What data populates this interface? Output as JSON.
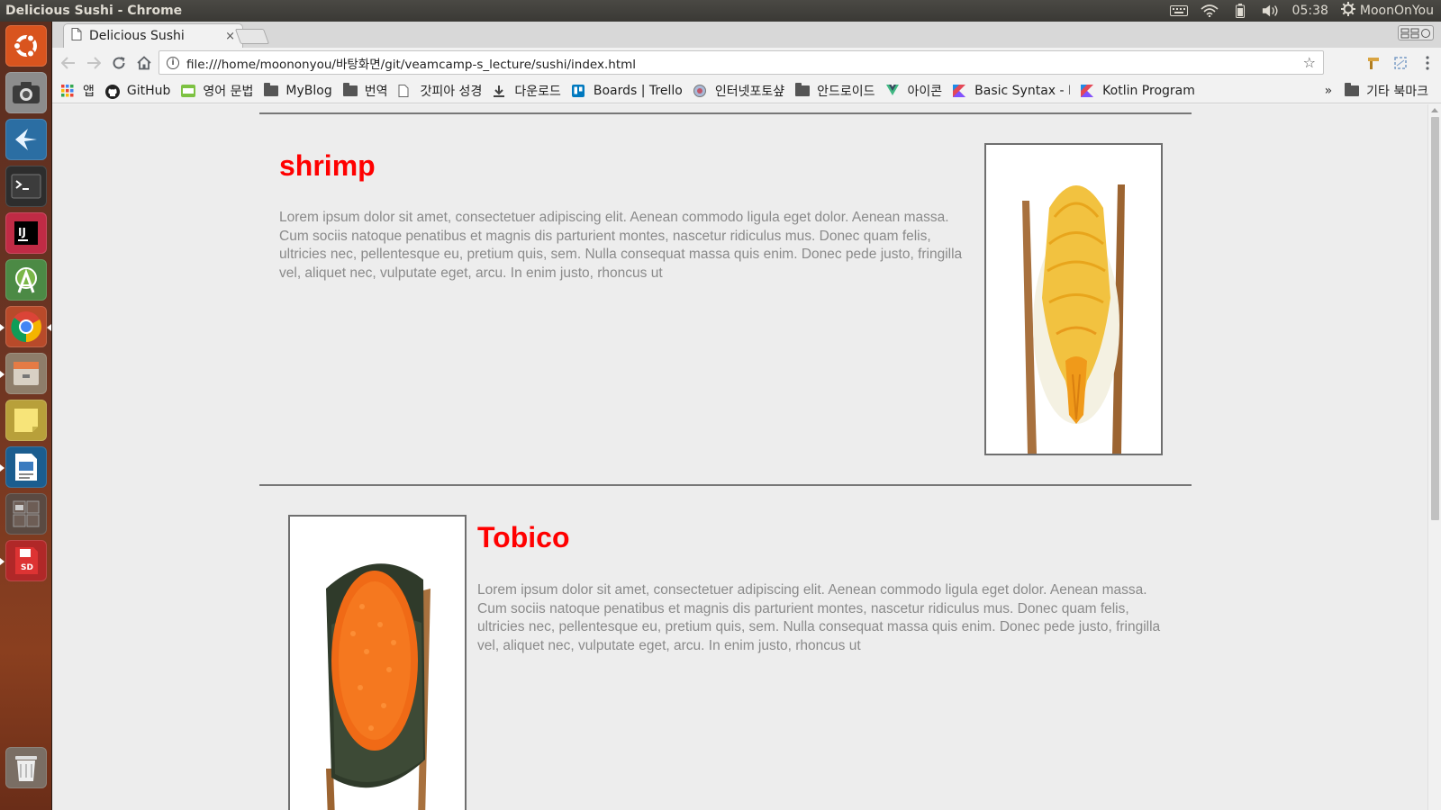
{
  "window": {
    "title": "Delicious Sushi - Chrome"
  },
  "panel": {
    "time": "05:38",
    "user": "MoonOnYou"
  },
  "launcher": {
    "items": [
      "ubuntu-dash",
      "screenshot",
      "remmina",
      "terminal",
      "intellij",
      "android-studio",
      "chrome",
      "files",
      "sticky-notes",
      "writer",
      "workspaces",
      "sd-app",
      "trash"
    ]
  },
  "tab": {
    "title": "Delicious Sushi",
    "close": "×"
  },
  "omnibox": {
    "url": "file:///home/moononyou/바탕화면/git/veamcamp-s_lecture/sushi/index.html"
  },
  "bookmarks": {
    "items": [
      {
        "label": "앱",
        "icon": "apps-grid-icon"
      },
      {
        "label": "GitHub",
        "icon": "github-icon"
      },
      {
        "label": "영어 문법",
        "icon": "blog-icon"
      },
      {
        "label": "MyBlog",
        "icon": "folder-icon"
      },
      {
        "label": "번역",
        "icon": "folder-icon"
      },
      {
        "label": "갓피아 성경",
        "icon": "page-icon"
      },
      {
        "label": "다운로드",
        "icon": "download-icon"
      },
      {
        "label": "Boards | Trello",
        "icon": "trello-icon"
      },
      {
        "label": "인터넷포토샾",
        "icon": "photoshop-icon"
      },
      {
        "label": "안드로이드",
        "icon": "folder-icon"
      },
      {
        "label": "아이콘",
        "icon": "vue-icon"
      },
      {
        "label": "Basic Syntax - K",
        "icon": "kotlin-icon"
      },
      {
        "label": "Kotlin Program",
        "icon": "kotlin-icon"
      }
    ],
    "more": "»",
    "other": "기타 북마크"
  },
  "sections": [
    {
      "title": "shrimp",
      "description": "Lorem ipsum dolor sit amet, consectetuer adipiscing elit. Aenean commodo ligula eget dolor. Aenean massa. Cum sociis natoque penatibus et magnis dis parturient montes, nascetur ridiculus mus. Donec quam felis, ultricies nec, pellentesque eu, pretium quis, sem. Nulla consequat massa quis enim. Donec pede justo, fringilla vel, aliquet nec, vulputate eget, arcu. In enim justo, rhoncus ut"
    },
    {
      "title": "Tobico",
      "description": "Lorem ipsum dolor sit amet, consectetuer adipiscing elit. Aenean commodo ligula eget dolor. Aenean massa. Cum sociis natoque penatibus et magnis dis parturient montes, nascetur ridiculus mus. Donec quam felis, ultricies nec, pellentesque eu, pretium quis, sem. Nulla consequat massa quis enim. Donec pede justo, fringilla vel, aliquet nec, vulputate eget, arcu. In enim justo, rhoncus ut"
    }
  ],
  "colors": {
    "title_red": "#ff0000",
    "body_gray": "#8a8a8a",
    "page_bg": "#ededed"
  }
}
